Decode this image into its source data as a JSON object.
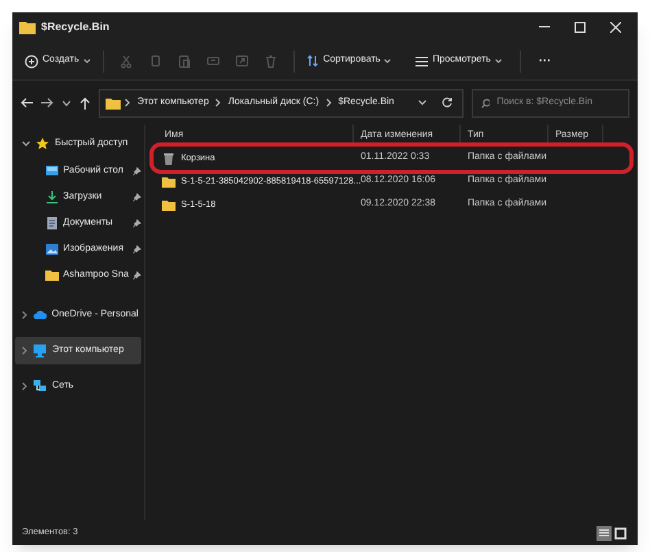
{
  "window": {
    "title": "$Recycle.Bin"
  },
  "toolbar": {
    "new_label": "Создать",
    "sort_label": "Сортировать",
    "view_label": "Просмотреть",
    "more": "···"
  },
  "address": {
    "path": [
      "Этот компьютер",
      "Локальный диск (C:)",
      "$Recycle.Bin"
    ],
    "search_placeholder": "Поиск в: $Recycle.Bin"
  },
  "sidebar": {
    "items": [
      {
        "label": "Быстрый доступ",
        "kind": "star",
        "expanded": true,
        "selected": false,
        "children": [
          {
            "label": "Рабочий стол",
            "kind": "desktop",
            "pinned": true
          },
          {
            "label": "Загрузки",
            "kind": "download",
            "pinned": true
          },
          {
            "label": "Документы",
            "kind": "document",
            "pinned": true
          },
          {
            "label": "Изображения",
            "kind": "image",
            "pinned": true
          },
          {
            "label": "Ashampoo Sna",
            "kind": "folder",
            "pinned": true
          }
        ]
      },
      {
        "label": "OneDrive - Personal",
        "kind": "cloud",
        "expanded": false,
        "selected": false
      },
      {
        "label": "Этот компьютер",
        "kind": "pc",
        "expanded": false,
        "selected": true
      },
      {
        "label": "Сеть",
        "kind": "network",
        "expanded": false,
        "selected": false
      }
    ]
  },
  "table": {
    "columns": [
      "Имя",
      "Дата изменения",
      "Тип",
      "Размер"
    ],
    "rows": [
      {
        "name": "Корзина",
        "kind": "bin",
        "date": "01.11.2022 0:33",
        "type": "Папка с файлами",
        "highlighted": true
      },
      {
        "name": "S-1-5-21-385042902-885819418-65597128...",
        "kind": "folder",
        "date": "08.12.2020 16:06",
        "type": "Папка с файлами",
        "highlighted": false
      },
      {
        "name": "S-1-5-18",
        "kind": "folder",
        "date": "09.12.2020 22:38",
        "type": "Папка с файлами",
        "highlighted": false
      }
    ]
  },
  "status_bar": {
    "text": "Элементов: 3"
  }
}
